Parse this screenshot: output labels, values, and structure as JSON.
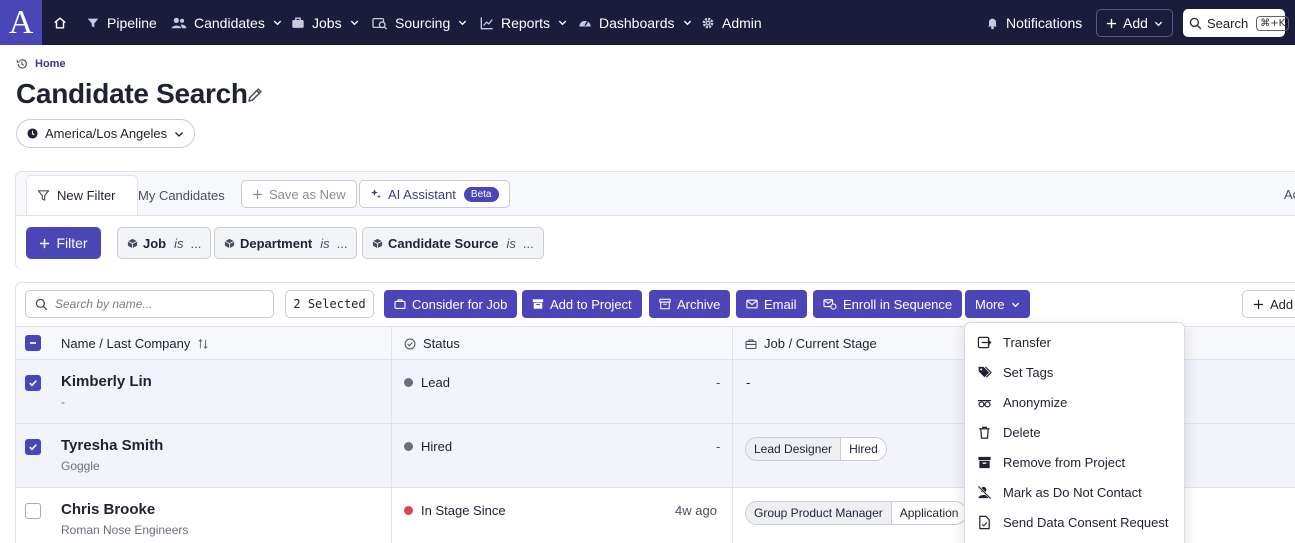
{
  "nav": {
    "logo_letter": "A",
    "items": [
      {
        "label": "Pipeline"
      },
      {
        "label": "Candidates"
      },
      {
        "label": "Jobs"
      },
      {
        "label": "Sourcing"
      },
      {
        "label": "Reports"
      },
      {
        "label": "Dashboards"
      },
      {
        "label": "Admin"
      }
    ],
    "notifications_label": "Notifications",
    "add_label": "Add",
    "search_label": "Search",
    "search_shortcut": "⌘+K"
  },
  "header": {
    "breadcrumb": "Home",
    "title": "Candidate Search",
    "timezone": "America/Los Angeles"
  },
  "filter_panel": {
    "tabs": {
      "new_filter": "New Filter",
      "my_candidates": "My Candidates",
      "save_as_new": "Save as New",
      "ai_assistant": "AI Assistant",
      "beta": "Beta",
      "cut_off_tab": "Ac"
    },
    "filter_button": "Filter",
    "chips": [
      {
        "field": "Job",
        "op": "is",
        "value": "..."
      },
      {
        "field": "Department",
        "op": "is",
        "value": "..."
      },
      {
        "field": "Candidate Source",
        "op": "is",
        "value": "..."
      }
    ]
  },
  "table": {
    "search_placeholder": "Search by name...",
    "selected_count": "2 Selected",
    "actions": {
      "consider_for_job": "Consider for Job",
      "add_to_project": "Add to Project",
      "archive": "Archive",
      "email": "Email",
      "enroll_in_sequence": "Enroll in Sequence",
      "more": "More"
    },
    "add_column_label": "Add",
    "columns": {
      "name": "Name / Last Company",
      "status": "Status",
      "job": "Job / Current Stage"
    },
    "rows": [
      {
        "name": "Kimberly Lin",
        "company": "-",
        "status": "Lead",
        "status_color": "#6b6e7c",
        "since": "-",
        "job": "-",
        "stage": "",
        "selected": true
      },
      {
        "name": "Tyresha Smith",
        "company": "Goggle",
        "status": "Hired",
        "status_color": "#6b6e7c",
        "since": "-",
        "job": "Lead Designer",
        "stage": "Hired",
        "selected": true
      },
      {
        "name": "Chris Brooke",
        "company": "Roman Nose Engineers",
        "status": "In Stage Since",
        "status_color": "#e0424f",
        "since": "4w ago",
        "job": "Group Product Manager",
        "stage": "Application",
        "selected": false
      }
    ]
  },
  "more_menu": {
    "items": [
      {
        "label": "Transfer",
        "icon": "transfer-icon"
      },
      {
        "label": "Set Tags",
        "icon": "tag-icon"
      },
      {
        "label": "Anonymize",
        "icon": "anonymize-icon"
      },
      {
        "label": "Delete",
        "icon": "trash-icon"
      },
      {
        "label": "Remove from Project",
        "icon": "archive-box-icon"
      },
      {
        "label": "Mark as Do Not Contact",
        "icon": "user-blocked-icon"
      },
      {
        "label": "Send Data Consent Request",
        "icon": "document-icon"
      }
    ]
  },
  "colors": {
    "nav_bg": "#1b1b3c",
    "accent": "#4b46b7",
    "status_red": "#e0424f",
    "status_gray": "#6b6e7c"
  }
}
